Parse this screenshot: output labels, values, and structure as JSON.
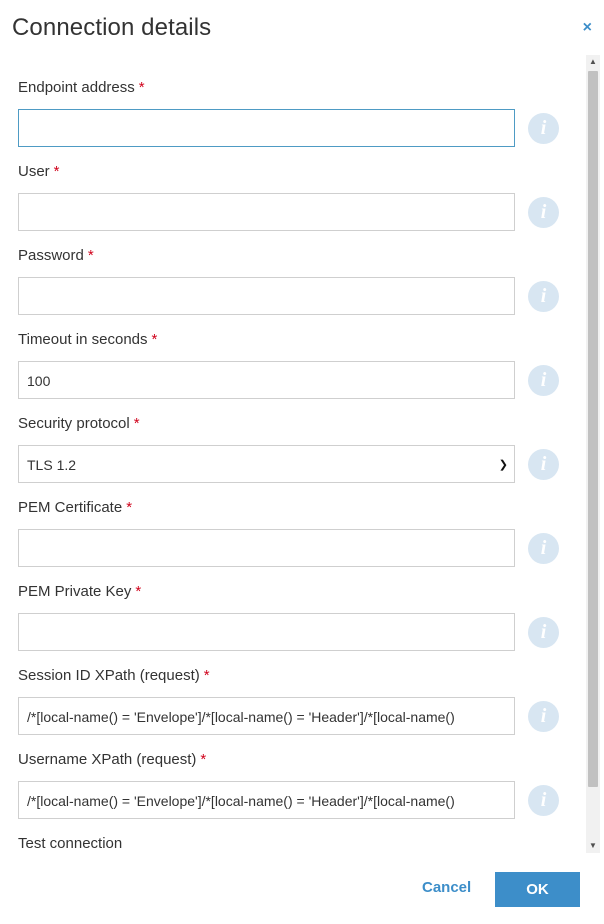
{
  "dialog": {
    "title": "Connection details",
    "close_icon": "×"
  },
  "required_marker": "*",
  "info_icon": "i",
  "fields": [
    {
      "label": "Endpoint address",
      "value": "",
      "type": "text",
      "focused": true
    },
    {
      "label": "User",
      "value": "",
      "type": "text"
    },
    {
      "label": "Password",
      "value": "",
      "type": "password"
    },
    {
      "label": "Timeout in seconds",
      "value": "100",
      "type": "text"
    },
    {
      "label": "Security protocol",
      "value": "TLS 1.2",
      "type": "select"
    },
    {
      "label": "PEM Certificate",
      "value": "",
      "type": "text"
    },
    {
      "label": "PEM Private Key",
      "value": "",
      "type": "text"
    },
    {
      "label": "Session ID XPath (request)",
      "value": "/*[local-name() = 'Envelope']/*[local-name() = 'Header']/*[local-name()",
      "type": "text"
    },
    {
      "label": "Username XPath (request)",
      "value": "/*[local-name() = 'Envelope']/*[local-name() = 'Header']/*[local-name()",
      "type": "text"
    }
  ],
  "test_connection": {
    "label": "Test connection"
  },
  "footer": {
    "cancel_label": "Cancel",
    "ok_label": "OK"
  },
  "colors": {
    "accent": "#3d8ec9",
    "required": "#d0021b",
    "info_bg": "#d8e6f2",
    "focus_border": "#4e9bc4"
  }
}
